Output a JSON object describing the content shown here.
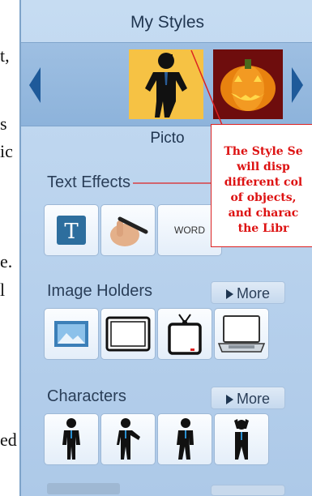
{
  "doc_fragments": [
    "t,",
    "s",
    "ic",
    "e.",
    "l",
    "ed"
  ],
  "panel": {
    "title": "My Styles",
    "style_name": "Picto",
    "sections": {
      "text_effects": {
        "label": "Text Effects",
        "word_tile": "WORD"
      },
      "image_holders": {
        "label": "Image Holders",
        "more": "More"
      },
      "characters": {
        "label": "Characters",
        "more": "More"
      }
    }
  },
  "callout": {
    "text": "The Style Se\nwill disp\ndifferent col\nof objects,\nand charac\nthe Libr"
  },
  "colors": {
    "picto_bg": "#f6c244",
    "pumpkin_bg": "#6e0d0d",
    "callout_red": "#dd1111",
    "arrow_blue": "#1e5a9a"
  }
}
